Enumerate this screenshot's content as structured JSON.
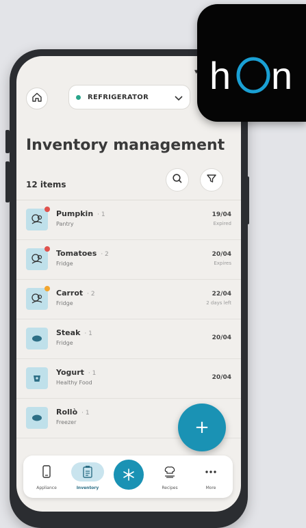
{
  "status_bar": {
    "icons": "▾◢"
  },
  "header": {
    "home_icon": "home-icon",
    "appliance": {
      "label": "REFRIGERATOR",
      "dot_color": "#2aa58b"
    }
  },
  "page": {
    "title": "Inventory management",
    "count": "12 items"
  },
  "items": [
    {
      "name": "Pumpkin",
      "qty": "1",
      "location": "Pantry",
      "date": "19/04",
      "note": "Expired",
      "badge": "#e0524d"
    },
    {
      "name": "Tomatoes",
      "qty": "2",
      "location": "Fridge",
      "date": "20/04",
      "note": "Expires",
      "badge": "#e0524d"
    },
    {
      "name": "Carrot",
      "qty": "2",
      "location": "Fridge",
      "date": "22/04",
      "note": "2 days left",
      "badge": "#f3a52e"
    },
    {
      "name": "Steak",
      "qty": "1",
      "location": "Fridge",
      "date": "20/04",
      "note": "",
      "badge": ""
    },
    {
      "name": "Yogurt",
      "qty": "1",
      "location": "Healthy Food",
      "date": "20/04",
      "note": "",
      "badge": ""
    },
    {
      "name": "Rollò",
      "qty": "1",
      "location": "Freezer",
      "date": "",
      "note": "",
      "badge": ""
    }
  ],
  "fab": {
    "label": "+"
  },
  "tabbar": {
    "tabs": [
      {
        "label": "Appliance"
      },
      {
        "label": "Inventory"
      },
      {
        "label": ""
      },
      {
        "label": "Recipes"
      },
      {
        "label": "More"
      }
    ]
  },
  "logo": {
    "text_h": "h",
    "text_n": "n",
    "ring_color": "#1aa0d4"
  },
  "colors": {
    "accent": "#1a92b4",
    "thumb": "#bfe0ea"
  }
}
